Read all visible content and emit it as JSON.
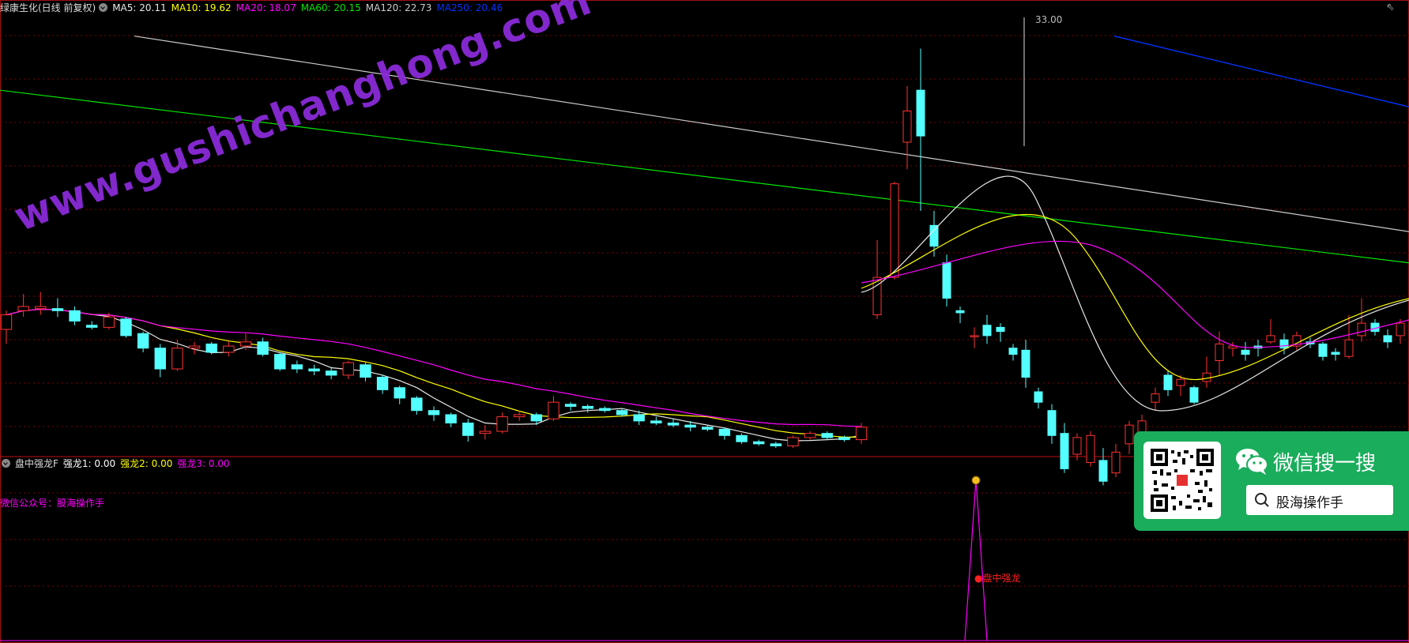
{
  "header": {
    "stock": "绿康生化(日线 前复权)",
    "ma": [
      {
        "label": "MA5: 20.11",
        "color": "#e8e8e8"
      },
      {
        "label": "MA10: 19.62",
        "color": "#ffff00"
      },
      {
        "label": "MA20: 18.07",
        "color": "#ff00ff"
      },
      {
        "label": "MA60: 20.15",
        "color": "#00e600"
      },
      {
        "label": "MA120: 22.73",
        "color": "#cccccc"
      },
      {
        "label": "MA250: 20.46",
        "color": "#0033ff"
      }
    ]
  },
  "indicator": {
    "name": "盘中强龙F",
    "values": [
      {
        "label": "强龙1: 0.00",
        "color": "#ffffff"
      },
      {
        "label": "强龙2: 0.00",
        "color": "#ffff00"
      },
      {
        "label": "强龙3: 0.00",
        "color": "#ff00ff"
      }
    ]
  },
  "annotations": {
    "max_price": "33.00",
    "wechat_text": "微信公众号：股海操作手",
    "signal_text": "●盘中强龙"
  },
  "watermark": "www.gushichanghong.com",
  "promo": {
    "title": "微信搜一搜",
    "search_text": "股海操作手"
  },
  "colors": {
    "up": "#ff3232",
    "down": "#54ffff",
    "grid": "#800000",
    "ma5": "#e8e8e8",
    "ma10": "#ffff00",
    "ma20": "#ff00ff",
    "ma60": "#00e600",
    "ma120": "#cccccc",
    "ma250": "#0033ff"
  },
  "chart_data": {
    "type": "candlestick",
    "price_range": [
      13.5,
      34.5
    ],
    "candles": [
      [
        19.5,
        20.2,
        18.8,
        20.4
      ],
      [
        20.4,
        20.6,
        20.1,
        21.2
      ],
      [
        20.5,
        20.6,
        20.2,
        21.3
      ],
      [
        20.5,
        20.4,
        20.1,
        21.0
      ],
      [
        20.4,
        19.9,
        19.7,
        20.6
      ],
      [
        19.7,
        19.6,
        19.5,
        19.9
      ],
      [
        19.6,
        20.1,
        19.5,
        20.3
      ],
      [
        20.0,
        19.2,
        19.1,
        20.1
      ],
      [
        19.3,
        18.6,
        18.4,
        19.4
      ],
      [
        18.6,
        17.6,
        17.2,
        18.8
      ],
      [
        17.6,
        18.6,
        17.5,
        19.0
      ],
      [
        18.6,
        18.7,
        18.3,
        18.9
      ],
      [
        18.8,
        18.4,
        18.3,
        18.9
      ],
      [
        18.4,
        18.7,
        18.2,
        18.9
      ],
      [
        18.7,
        18.9,
        18.5,
        19.3
      ],
      [
        18.9,
        18.3,
        18.2,
        19.1
      ],
      [
        18.3,
        17.6,
        17.5,
        18.4
      ],
      [
        17.8,
        17.6,
        17.4,
        18.0
      ],
      [
        17.6,
        17.5,
        17.3,
        17.8
      ],
      [
        17.5,
        17.3,
        17.1,
        17.7
      ],
      [
        17.3,
        17.9,
        17.1,
        18.0
      ],
      [
        17.8,
        17.2,
        17.0,
        17.9
      ],
      [
        17.2,
        16.6,
        16.4,
        17.3
      ],
      [
        16.7,
        16.2,
        15.9,
        16.8
      ],
      [
        16.2,
        15.6,
        15.4,
        16.3
      ],
      [
        15.6,
        15.4,
        15.1,
        15.8
      ],
      [
        15.4,
        15.0,
        14.8,
        15.5
      ],
      [
        15.0,
        14.4,
        14.1,
        15.2
      ],
      [
        14.5,
        14.6,
        14.2,
        14.9
      ],
      [
        14.6,
        15.3,
        14.5,
        15.5
      ],
      [
        15.3,
        15.4,
        15.1,
        15.6
      ],
      [
        15.4,
        15.1,
        14.9,
        15.5
      ],
      [
        15.2,
        16.0,
        15.1,
        16.3
      ],
      [
        15.9,
        15.8,
        15.6,
        16.0
      ],
      [
        15.8,
        15.7,
        15.5,
        15.9
      ],
      [
        15.7,
        15.6,
        15.5,
        15.8
      ],
      [
        15.6,
        15.4,
        15.3,
        15.7
      ],
      [
        15.4,
        15.1,
        14.9,
        15.6
      ],
      [
        15.1,
        15.0,
        14.9,
        15.3
      ],
      [
        15.0,
        14.9,
        14.8,
        15.2
      ],
      [
        14.9,
        14.8,
        14.6,
        15.1
      ],
      [
        14.8,
        14.7,
        14.6,
        14.9
      ],
      [
        14.7,
        14.4,
        14.2,
        14.8
      ],
      [
        14.4,
        14.1,
        14.0,
        14.5
      ],
      [
        14.1,
        14.0,
        13.9,
        14.2
      ],
      [
        14.0,
        13.9,
        13.8,
        14.1
      ],
      [
        13.9,
        14.3,
        13.8,
        14.4
      ],
      [
        14.3,
        14.5,
        14.2,
        14.6
      ],
      [
        14.5,
        14.3,
        14.2,
        14.6
      ],
      [
        14.3,
        14.2,
        14.1,
        14.4
      ],
      [
        14.2,
        14.8,
        14.0,
        15.0
      ]
    ]
  }
}
